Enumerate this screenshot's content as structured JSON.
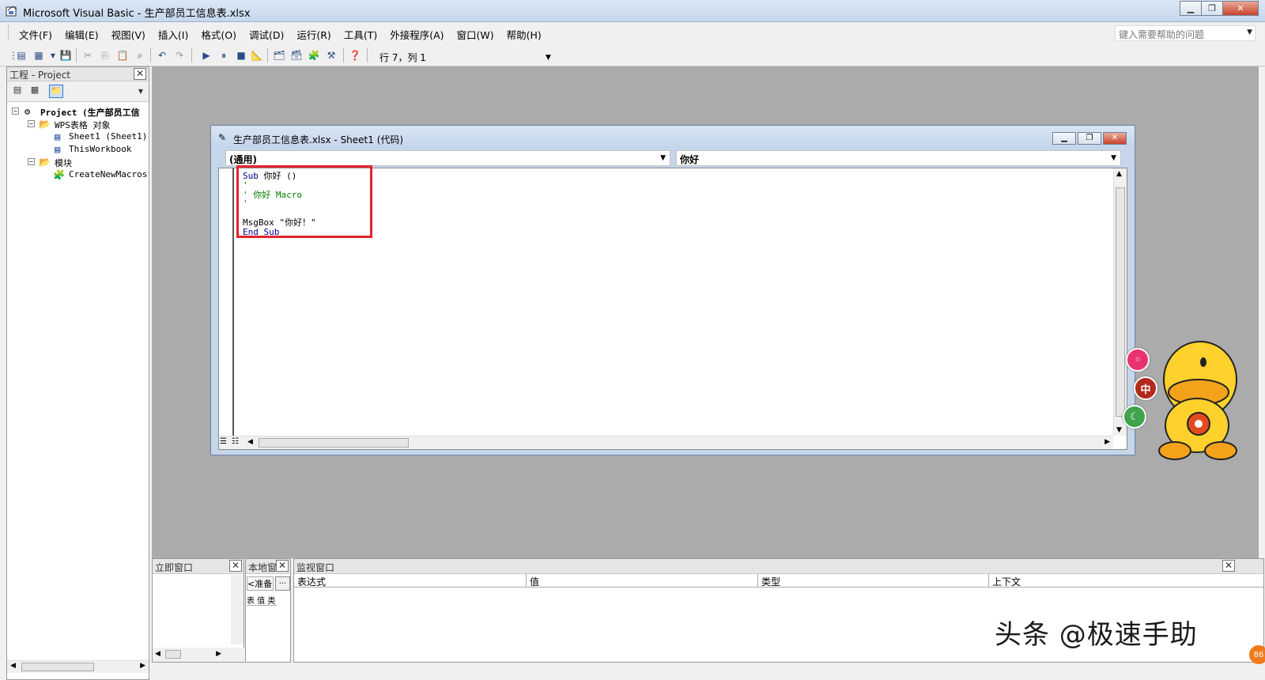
{
  "window": {
    "title": "Microsoft Visual Basic - 生产部员工信息表.xlsx"
  },
  "menu": [
    "文件(F)",
    "编辑(E)",
    "视图(V)",
    "插入(I)",
    "格式(O)",
    "调试(D)",
    "运行(R)",
    "工具(T)",
    "外接程序(A)",
    "窗口(W)",
    "帮助(H)"
  ],
  "help_search": {
    "placeholder": "键入需要帮助的问题"
  },
  "toolbar": {
    "position": "行 7，列 1"
  },
  "project_panel": {
    "title": "工程 - Project",
    "tree": {
      "project": "Project (生产部员工信",
      "wps_folder": "WPS表格 对象",
      "sheet1": "Sheet1 (Sheet1)",
      "thisworkbook": "ThisWorkbook",
      "modules_folder": "模块",
      "module": "CreateNewMacros"
    }
  },
  "code_window": {
    "title": "生产部员工信息表.xlsx - Sheet1 (代码)",
    "object_combo": "(通用)",
    "proc_combo": "你好",
    "lines": {
      "l1_kw": "Sub",
      "l1_rest": " 你好 ()",
      "l2": "'",
      "l3": "' 你好 Macro",
      "l4": "'",
      "l5": "",
      "l6": "MsgBox \"你好！\"",
      "l7": "End Sub"
    }
  },
  "immediate": {
    "title": "立即窗口"
  },
  "locals": {
    "title": "本地窗口",
    "field": "<准备",
    "btn": "...",
    "cols": "表 值 类"
  },
  "watch": {
    "title": "监视窗口",
    "columns": [
      "表达式",
      "值",
      "类型",
      "上下文"
    ]
  },
  "watermark": "头条 @极速手助",
  "floater": {
    "badge": "86",
    "btn_cn": "中"
  }
}
